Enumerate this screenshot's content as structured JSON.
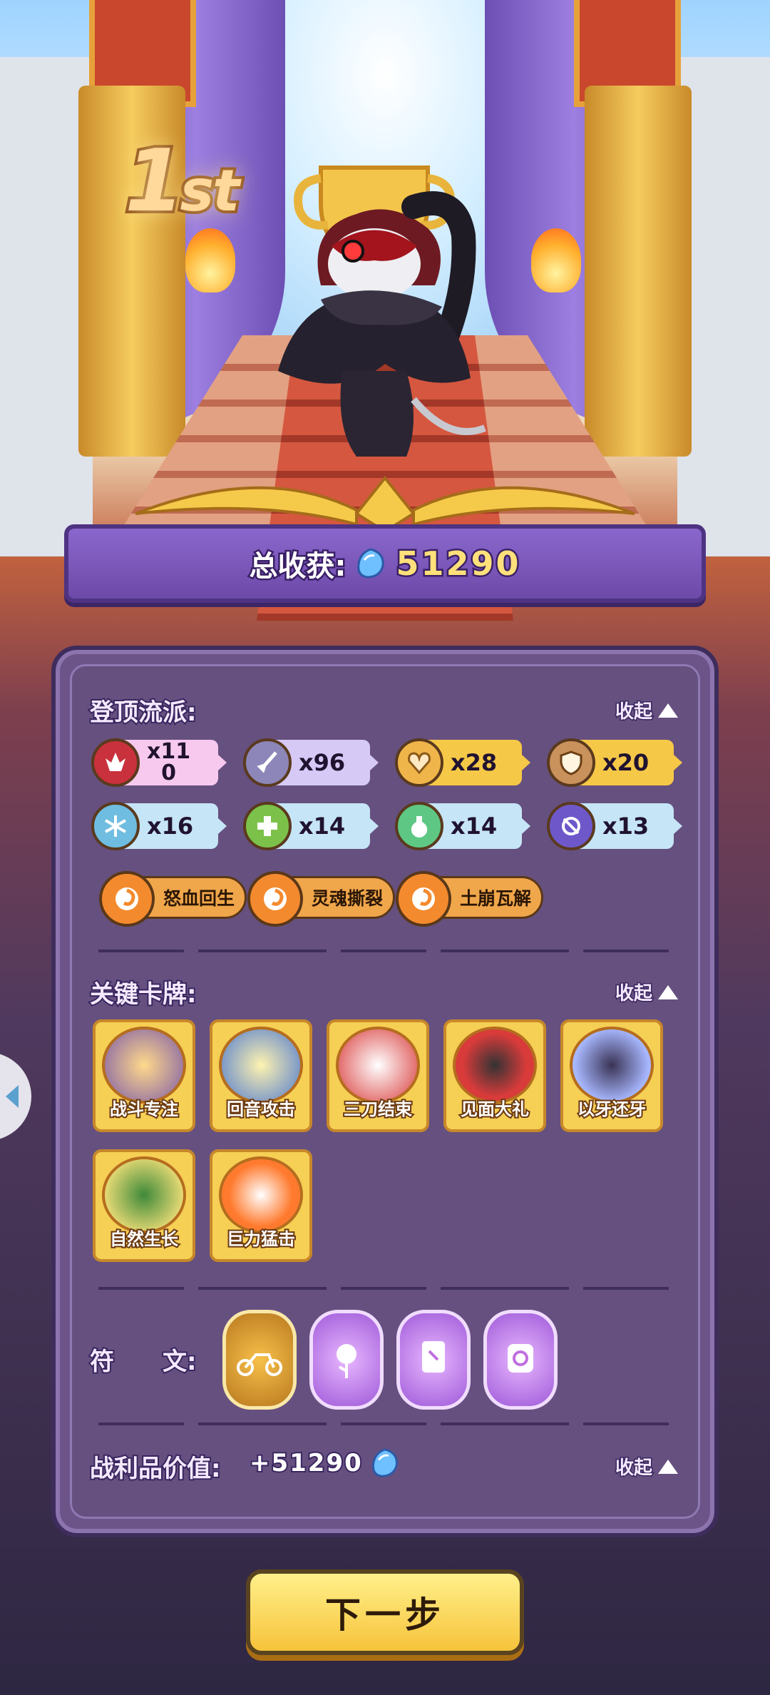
{
  "rank": {
    "number": "1",
    "suffix": "st"
  },
  "total": {
    "label": "总收获:",
    "value": "51290",
    "icon": "blue-gem-icon"
  },
  "sections": {
    "school": {
      "title": "登顶流派:",
      "collapse_label": "收起"
    },
    "cards": {
      "title": "关键卡牌:",
      "collapse_label": "收起"
    },
    "runes": {
      "title": "符　　文:"
    },
    "loot": {
      "title": "战利品价值:",
      "value": "+51290",
      "collapse_label": "收起"
    }
  },
  "tags": [
    {
      "icon": "rage-icon",
      "count": "x11\n0"
    },
    {
      "icon": "sword-icon",
      "count": "x96"
    },
    {
      "icon": "heart-icon",
      "count": "x28"
    },
    {
      "icon": "shield-icon",
      "count": "x20"
    },
    {
      "icon": "snowflake-icon",
      "count": "x16"
    },
    {
      "icon": "heal-cross-icon",
      "count": "x14"
    },
    {
      "icon": "potion-icon",
      "count": "x14"
    },
    {
      "icon": "cycle-icon",
      "count": "x13"
    }
  ],
  "skills": [
    "怒血回生",
    "灵魂撕裂",
    "土崩瓦解"
  ],
  "cards": [
    "战斗专注",
    "回音攻击",
    "三刀结束",
    "见面大礼",
    "以牙还牙",
    "自然生长",
    "巨力猛击"
  ],
  "runes": [
    "motorbike-rune-icon",
    "rose-rune-icon",
    "card-rune-icon",
    "scroll-rune-icon"
  ],
  "next_button": {
    "label": "下一步"
  },
  "colors": {
    "panel": "#6c5488",
    "accent_gold": "#f7c33b",
    "banner": "#7b59bf"
  }
}
